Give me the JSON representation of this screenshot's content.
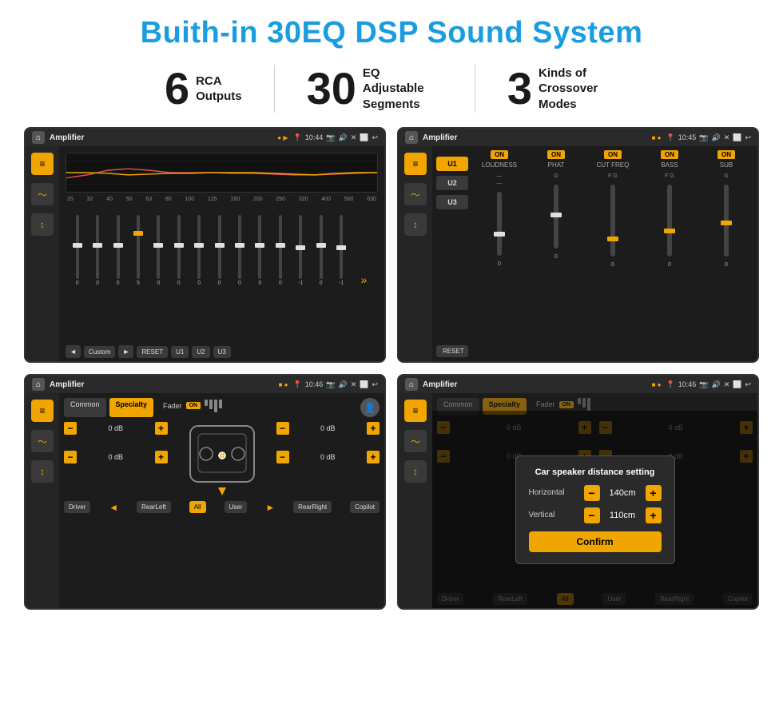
{
  "page": {
    "title": "Buith-in 30EQ DSP Sound System",
    "stats": [
      {
        "number": "6",
        "label": "RCA\nOutputs"
      },
      {
        "number": "30",
        "label": "EQ Adjustable\nSegments"
      },
      {
        "number": "3",
        "label": "Kinds of\nCrossover Modes"
      }
    ]
  },
  "screens": {
    "screen1": {
      "title": "Amplifier",
      "time": "10:44",
      "eq_labels": [
        "25",
        "32",
        "40",
        "50",
        "63",
        "80",
        "100",
        "125",
        "160",
        "200",
        "250",
        "320",
        "400",
        "500",
        "630"
      ],
      "eq_values": [
        "0",
        "0",
        "0",
        "5",
        "0",
        "0",
        "0",
        "0",
        "0",
        "0",
        "0",
        "-1",
        "0",
        "-1"
      ],
      "bottom_btns": [
        "Custom",
        "RESET",
        "U1",
        "U2",
        "U3"
      ]
    },
    "screen2": {
      "title": "Amplifier",
      "time": "10:45",
      "channels": [
        "LOUDNESS",
        "PHAT",
        "CUT FREQ",
        "BASS",
        "SUB"
      ],
      "u_buttons": [
        "U1",
        "U2",
        "U3"
      ],
      "reset_label": "RESET"
    },
    "screen3": {
      "title": "Amplifier",
      "time": "10:46",
      "tabs": [
        "Common",
        "Specialty"
      ],
      "fader_label": "Fader",
      "fader_on": "ON",
      "db_values": [
        "0 dB",
        "0 dB",
        "0 dB",
        "0 dB"
      ],
      "nav_btns": [
        "Driver",
        "RearLeft",
        "All",
        "User",
        "RearRight",
        "Copilot"
      ]
    },
    "screen4": {
      "title": "Amplifier",
      "time": "10:46",
      "tabs": [
        "Common",
        "Specialty"
      ],
      "fader_on": "ON",
      "dialog": {
        "title": "Car speaker distance setting",
        "horizontal_label": "Horizontal",
        "horizontal_value": "140cm",
        "vertical_label": "Vertical",
        "vertical_value": "110cm",
        "confirm_label": "Confirm"
      },
      "db_values": [
        "0 dB",
        "0 dB"
      ],
      "nav_btns": [
        "Driver",
        "RearLeft",
        "All",
        "User",
        "RearRight",
        "Copilot"
      ]
    }
  },
  "icons": {
    "home": "⌂",
    "location": "📍",
    "volume": "🔊",
    "back": "↩",
    "camera": "📷",
    "close": "✕",
    "window": "⬜",
    "eq_icon": "≡",
    "wave_icon": "〜",
    "arrows_icon": "↕",
    "minus": "−",
    "plus": "+"
  }
}
